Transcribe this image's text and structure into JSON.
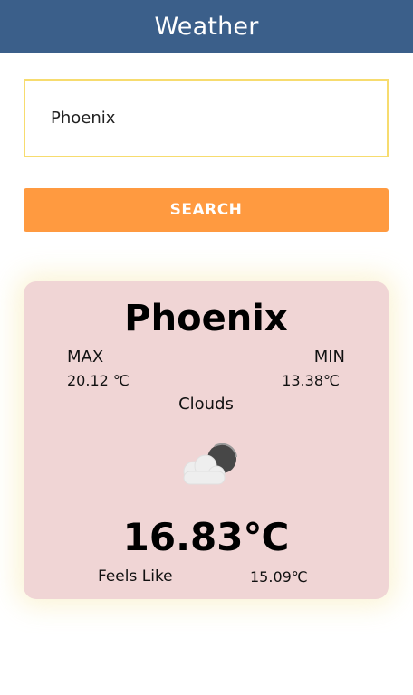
{
  "header": {
    "title": "Weather"
  },
  "search": {
    "value": "Phoenix",
    "button_label": "SEARCH"
  },
  "weather": {
    "city": "Phoenix",
    "max_label": "MAX",
    "min_label": "MIN",
    "max_value": "20.12 ℃",
    "min_value": "13.38℃",
    "condition": "Clouds",
    "icon": "partly-cloudy-night-icon",
    "temperature": "16.83℃",
    "feels_like_label": "Feels Like",
    "feels_like_value": "15.09℃"
  },
  "colors": {
    "header": "#3b5f8a",
    "input_border": "#f7dc6f",
    "button": "#ff9a40",
    "card": "#f0d5d5"
  }
}
